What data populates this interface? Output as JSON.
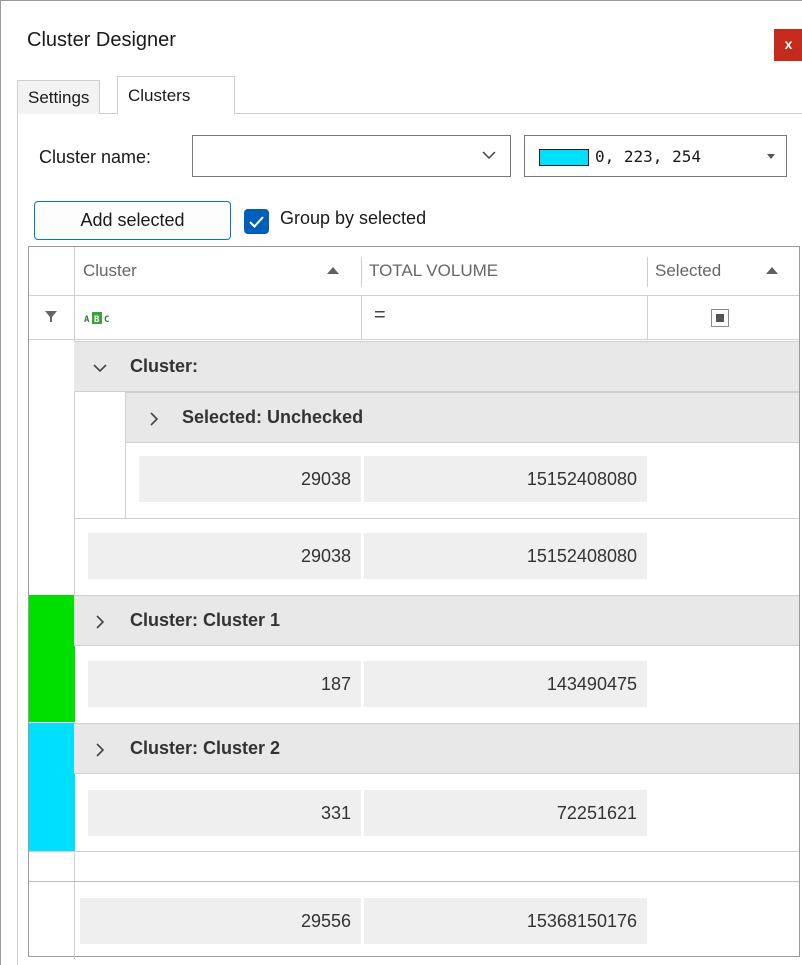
{
  "window": {
    "title": "Cluster Designer",
    "close_label": "x"
  },
  "tabs": [
    {
      "label": "Settings",
      "active": false
    },
    {
      "label": "Clusters",
      "active": true
    }
  ],
  "cluster_name": {
    "label": "Cluster name:",
    "value": "",
    "placeholder": ""
  },
  "color_picker": {
    "swatch_color": "#00dffe",
    "value": "0, 223, 254"
  },
  "actions": {
    "add_selected_label": "Add selected",
    "group_by_selected_label": "Group by selected",
    "group_by_selected_checked": true
  },
  "grid": {
    "columns": [
      {
        "header": "Cluster",
        "sort": "ascending"
      },
      {
        "header": "TOTAL VOLUME"
      },
      {
        "header": "Selected",
        "sort": "ascending"
      }
    ],
    "filter_row": {
      "cluster_filter_icon": "abc-text-filter-icon",
      "volume_operator": "="
    },
    "groups": [
      {
        "label": "Cluster:",
        "expanded": true,
        "subgroup": {
          "label": "Selected: Unchecked",
          "expanded": false,
          "summary": [
            "29038",
            "15152408080"
          ]
        },
        "summary": [
          "29038",
          "15152408080"
        ]
      },
      {
        "label": "Cluster: Cluster 1",
        "expanded": false,
        "color": "#00e000",
        "summary": [
          "187",
          "143490475"
        ]
      },
      {
        "label": "Cluster: Cluster 2",
        "expanded": false,
        "color": "#00dffe",
        "summary": [
          "331",
          "72251621"
        ]
      }
    ],
    "total": [
      "29556",
      "15368150176"
    ]
  },
  "colors": {
    "accent": "#005fb8",
    "close": "#c42b1c"
  }
}
